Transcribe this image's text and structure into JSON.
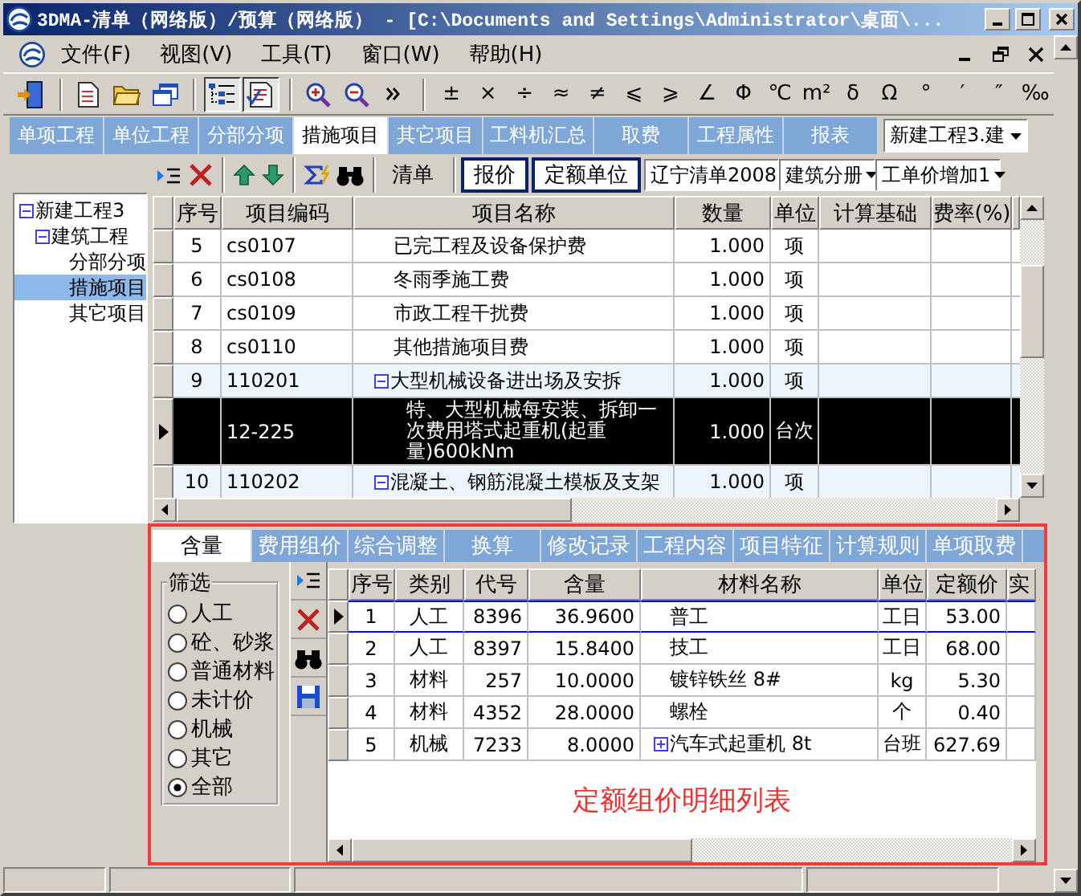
{
  "window": {
    "title": "3DMA-清单（网络版）/预算（网络版） - [C:\\Documents and Settings\\Administrator\\桌面\\..."
  },
  "menu": [
    {
      "label": "文件(F)"
    },
    {
      "label": "视图(V)"
    },
    {
      "label": "工具(T)"
    },
    {
      "label": "窗口(W)"
    },
    {
      "label": "帮助(H)"
    }
  ],
  "toolbar": {
    "view_toggles": [
      {
        "pressed": true
      },
      {
        "pressed": true
      }
    ],
    "symbols": [
      "±",
      "×",
      "÷",
      "≈",
      "≠",
      "⩽",
      "⩾",
      "∠",
      "Φ",
      "℃",
      "m²",
      "δ",
      "Ω",
      "°",
      "′",
      "″",
      "‰"
    ]
  },
  "main_tabs": [
    {
      "label": "单项工程",
      "selected": false
    },
    {
      "label": "单位工程",
      "selected": false
    },
    {
      "label": "分部分项",
      "selected": false
    },
    {
      "label": "措施项目",
      "selected": true
    },
    {
      "label": "其它项目",
      "selected": false
    },
    {
      "label": "工料机汇总",
      "selected": false
    },
    {
      "label": "取费",
      "selected": false
    },
    {
      "label": "工程属性",
      "selected": false
    },
    {
      "label": "报表",
      "selected": false
    }
  ],
  "project_selector": {
    "value": "新建工程3.建"
  },
  "tree": [
    {
      "label": "新建工程3",
      "expanded": true,
      "selected": false,
      "children": [
        {
          "label": "建筑工程",
          "expanded": true,
          "selected": false,
          "children": [
            {
              "label": "分部分项",
              "selected": false
            },
            {
              "label": "措施项目",
              "selected": true
            },
            {
              "label": "其它项目",
              "selected": false
            }
          ]
        }
      ]
    }
  ],
  "bill_toolbar": {
    "buttons": [
      {
        "label": "清单",
        "pressed": false
      },
      {
        "label": "报价",
        "pressed": true
      },
      {
        "label": "定额单位",
        "pressed": true
      }
    ],
    "dropdowns": [
      {
        "value": "辽宁清单2008"
      },
      {
        "value": "建筑分册"
      },
      {
        "value": "工单价增加1"
      }
    ]
  },
  "bill_table": {
    "columns": [
      "序号",
      "项目编码",
      "项目名称",
      "数量",
      "单位",
      "计算基础",
      "费率(%)"
    ],
    "rows": [
      {
        "kind": "item",
        "no": "5",
        "code": "cs0107",
        "name": "已完工程及设备保护费",
        "quantity": "1.000",
        "unit": "项",
        "selected": false
      },
      {
        "kind": "item",
        "no": "6",
        "code": "cs0108",
        "name": "冬雨季施工费",
        "quantity": "1.000",
        "unit": "项",
        "selected": false
      },
      {
        "kind": "item",
        "no": "7",
        "code": "cs0109",
        "name": "市政工程干扰费",
        "quantity": "1.000",
        "unit": "项",
        "selected": false
      },
      {
        "kind": "item",
        "no": "8",
        "code": "cs0110",
        "name": "其他措施项目费",
        "quantity": "1.000",
        "unit": "项",
        "selected": false
      },
      {
        "kind": "group",
        "no": "9",
        "code": "110201",
        "name": "大型机械设备进出场及安拆",
        "quantity": "1.000",
        "unit": "项",
        "expanded": true,
        "selected": false
      },
      {
        "kind": "quota",
        "code": "12-225",
        "name": "特、大型机械每安装、拆卸一次费用塔式起重机(起重量)600kNm",
        "quantity": "1.000",
        "unit": "台次",
        "selected": true
      },
      {
        "kind": "group",
        "no": "10",
        "code": "110202",
        "name": "混凝土、钢筋混凝土模板及支架",
        "quantity": "1.000",
        "unit": "项",
        "expanded": true,
        "selected": false
      }
    ]
  },
  "detail_panel": {
    "tabs": [
      {
        "label": "含量",
        "selected": true
      },
      {
        "label": "费用组价",
        "selected": false
      },
      {
        "label": "综合调整",
        "selected": false
      },
      {
        "label": "换算",
        "selected": false
      },
      {
        "label": "修改记录",
        "selected": false
      },
      {
        "label": "工程内容",
        "selected": false
      },
      {
        "label": "项目特征",
        "selected": false
      },
      {
        "label": "计算规则",
        "selected": false
      },
      {
        "label": "单项取费",
        "selected": false
      }
    ],
    "filter": {
      "title": "筛选",
      "options": [
        {
          "label": "人工",
          "selected": false
        },
        {
          "label": "砼、砂浆",
          "selected": false
        },
        {
          "label": "普通材料",
          "selected": false
        },
        {
          "label": "未计价",
          "selected": false
        },
        {
          "label": "机械",
          "selected": false
        },
        {
          "label": "其它",
          "selected": false
        },
        {
          "label": "全部",
          "selected": true
        }
      ]
    },
    "table": {
      "columns": [
        "序号",
        "类别",
        "代号",
        "含量",
        "材料名称",
        "单位",
        "定额价",
        "实"
      ],
      "rows": [
        {
          "kind": "item",
          "no": "1",
          "category": "人工",
          "code": "8396",
          "amount": "36.9600",
          "name": "普工",
          "unit": "工日",
          "price": "53.00",
          "selected": true
        },
        {
          "kind": "item",
          "no": "2",
          "category": "人工",
          "code": "8397",
          "amount": "15.8400",
          "name": "技工",
          "unit": "工日",
          "price": "68.00",
          "selected": false
        },
        {
          "kind": "item",
          "no": "3",
          "category": "材料",
          "code": "257",
          "amount": "10.0000",
          "name": "镀锌铁丝 8#",
          "unit": "kg",
          "price": "5.30",
          "selected": false
        },
        {
          "kind": "item",
          "no": "4",
          "category": "材料",
          "code": "4352",
          "amount": "28.0000",
          "name": "螺栓",
          "unit": "个",
          "price": "0.40",
          "selected": false
        },
        {
          "kind": "group",
          "no": "5",
          "category": "机械",
          "code": "7233",
          "amount": "8.0000",
          "name": "汽车式起重机 8t",
          "unit": "台班",
          "price": "627.69",
          "expanded": false,
          "selected": false
        }
      ]
    },
    "caption": "定额组价明细列表"
  }
}
